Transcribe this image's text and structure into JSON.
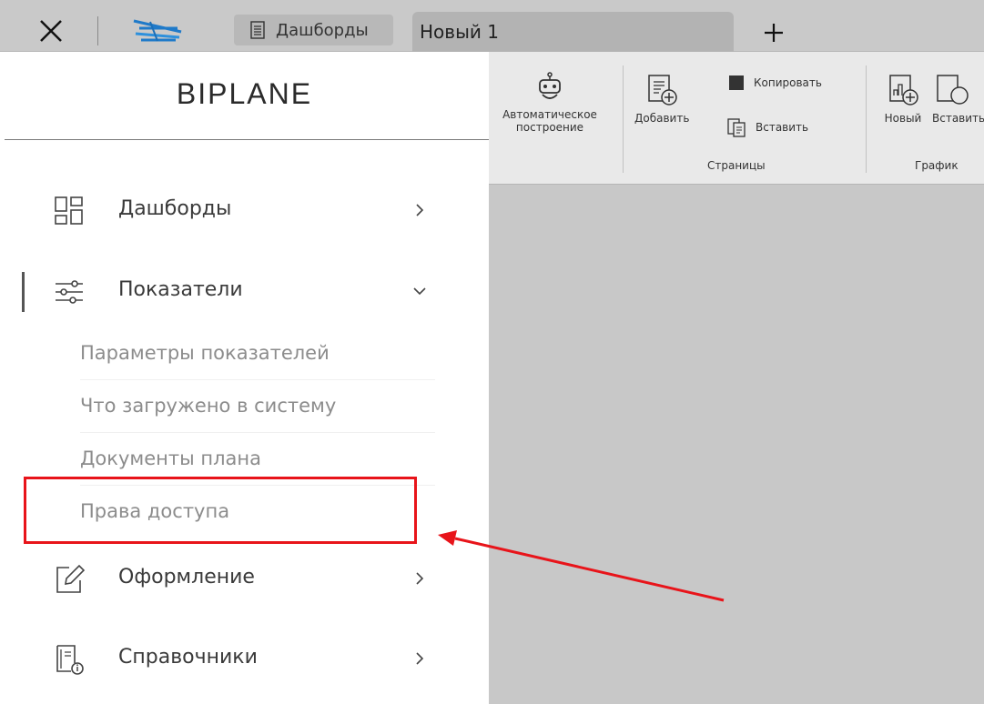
{
  "tabs": {
    "close_icon": "close-icon",
    "dashboards_label": "Дашборды",
    "active_label": "Новый 1",
    "add_icon": "plus-icon"
  },
  "ribbon": {
    "auto_build": {
      "label_line1": "Автоматическое",
      "label_line2": "построение",
      "icon": "robot-icon"
    },
    "pages": {
      "add_label": "Добавить",
      "copy_label": "Копировать",
      "paste_label": "Вставить",
      "group_label": "Страницы"
    },
    "chart": {
      "new_label": "Новый",
      "paste_label": "Вставить",
      "group_label": "График"
    }
  },
  "sidebar": {
    "brand": "BIPLANE",
    "items": [
      {
        "label": "Дашборды",
        "icon": "dashboard-grid-icon",
        "expanded": false
      },
      {
        "label": "Показатели",
        "icon": "sliders-icon",
        "expanded": true,
        "subitems": [
          {
            "label": "Параметры показателей"
          },
          {
            "label": "Что загружено в систему"
          },
          {
            "label": "Документы плана"
          },
          {
            "label": "Права доступа"
          }
        ]
      },
      {
        "label": "Оформление",
        "icon": "edit-icon",
        "expanded": false
      },
      {
        "label": "Справочники",
        "icon": "reference-book-icon",
        "expanded": false
      }
    ]
  },
  "colors": {
    "highlight": "#e8141a",
    "sidebar_bg": "#ffffff",
    "workspace_bg": "#c8c8c8",
    "submenu_text": "#8c8c8c"
  }
}
